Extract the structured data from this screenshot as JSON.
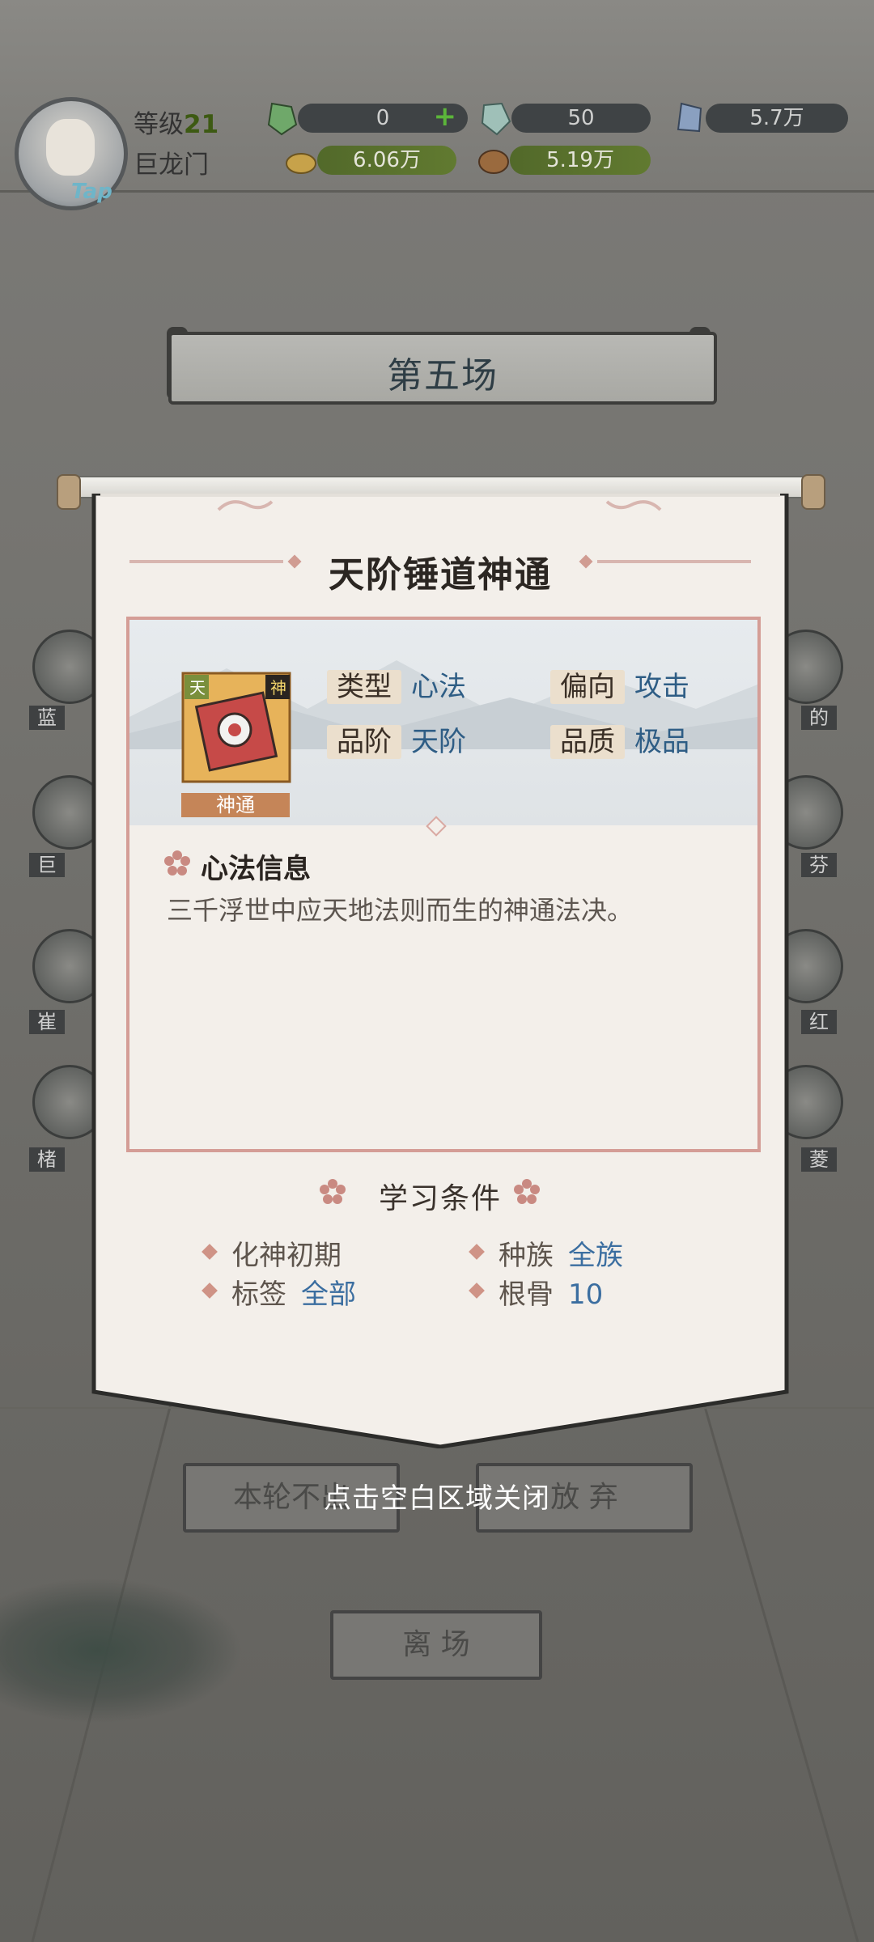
{
  "header": {
    "level_label": "等级",
    "level_value": "21",
    "sect": "巨龙门",
    "tap": "Tap",
    "resources": [
      {
        "name": "spirit-stone",
        "value": "0",
        "color": "#6fa86a"
      },
      {
        "name": "rainbow-stone",
        "value": "50",
        "color": "#9fc0b8"
      },
      {
        "name": "crystal",
        "value": "5.7万",
        "color": "#8aa0c0"
      },
      {
        "name": "gold",
        "value": "6.06万",
        "color": "#c7a24a"
      },
      {
        "name": "ore",
        "value": "5.19万",
        "color": "#9a6a3e"
      }
    ]
  },
  "scene": {
    "round_title": "第五场",
    "left_names": [
      "蓝",
      "巨",
      "崔",
      "楮"
    ],
    "right_names": [
      "的",
      "芬",
      "红",
      "菱"
    ],
    "buttons": {
      "skip": "本轮不出",
      "giveup": "放 弃",
      "leave": "离 场"
    }
  },
  "popup": {
    "title": "天阶锤道神通",
    "item": {
      "badge_tl": "天",
      "badge_tr": "神",
      "label": "神通"
    },
    "stats": {
      "type_key": "类型",
      "type_val": "心法",
      "bias_key": "偏向",
      "bias_val": "攻击",
      "grade_key": "品阶",
      "grade_val": "天阶",
      "quality_key": "品质",
      "quality_val": "极品"
    },
    "info_title": "心法信息",
    "info_desc": "三千浮世中应天地法则而生的神通法决。",
    "req_title": "学习条件",
    "requirements": {
      "realm": "化神初期",
      "race_key": "种族",
      "race_val": "全族",
      "tag_key": "标签",
      "tag_val": "全部",
      "bone_key": "根骨",
      "bone_val": "10"
    },
    "close_hint": "点击空白区域关闭"
  },
  "colors": {
    "paper": "#f3efea",
    "accent_pink": "#d49d96",
    "value_blue": "#2e5d85",
    "label_orange": "#c58558"
  }
}
